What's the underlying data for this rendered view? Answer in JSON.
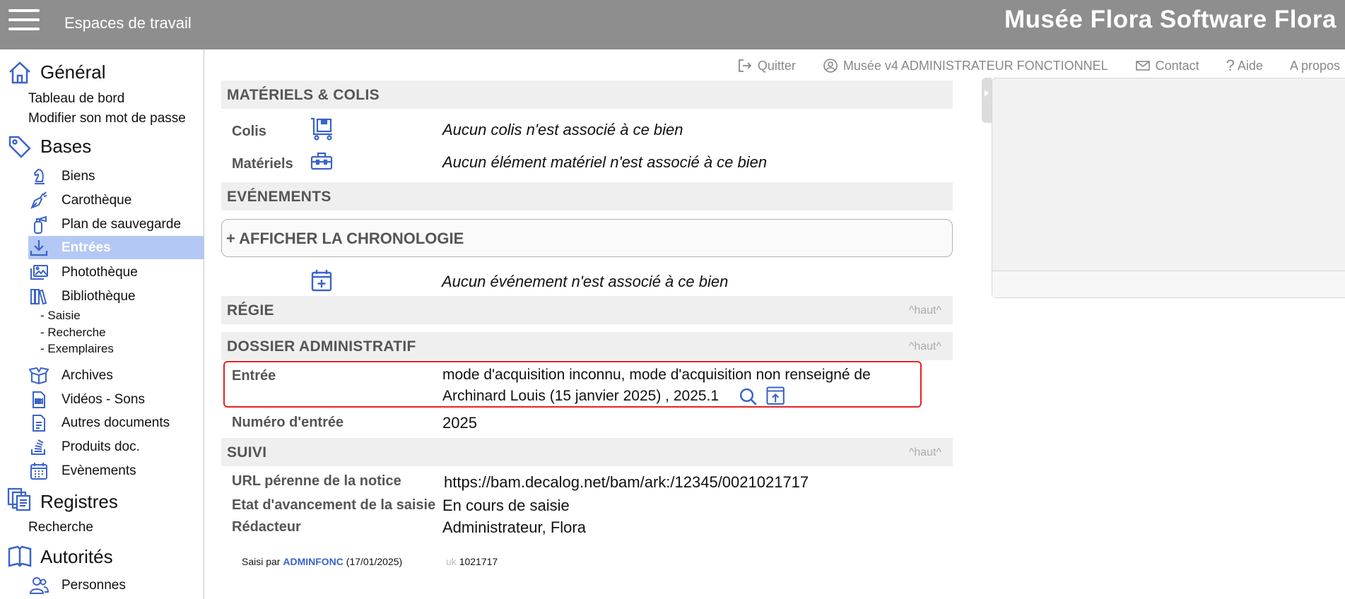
{
  "topbar": {
    "workspaces_label": "Espaces de travail",
    "brand": "Musée Flora Software Flora"
  },
  "utilbar": {
    "quit": "Quitter",
    "user": "Musée v4 ADMINISTRATEUR FONCTIONNEL",
    "contact": "Contact",
    "help": "Aide",
    "about": "A propos"
  },
  "sidebar": {
    "general": {
      "title": "Général",
      "links": [
        "Tableau de bord",
        "Modifier son mot de passe"
      ]
    },
    "bases": {
      "title": "Bases",
      "items": [
        {
          "label": "Biens",
          "icon": "chess-knight-icon"
        },
        {
          "label": "Carothèque",
          "icon": "pen-nib-icon"
        },
        {
          "label": "Plan de sauvegarde",
          "icon": "fire-extinguisher-icon"
        },
        {
          "label": "Entrées",
          "icon": "download-tray-icon"
        },
        {
          "label": "Photothèque",
          "icon": "images-icon"
        },
        {
          "label": "Bibliothèque",
          "icon": "books-icon"
        },
        {
          "label": "Archives",
          "icon": "open-box-icon"
        },
        {
          "label": "Vidéos - Sons",
          "icon": "video-file-icon"
        },
        {
          "label": "Autres documents",
          "icon": "document-icon"
        },
        {
          "label": "Produits doc.",
          "icon": "stack-icon"
        },
        {
          "label": "Evènements",
          "icon": "calendar-icon"
        }
      ],
      "library_sub": [
        "- Saisie",
        "- Recherche",
        "- Exemplaires"
      ]
    },
    "registres": {
      "title": "Registres",
      "links": [
        "Recherche"
      ]
    },
    "autorites": {
      "title": "Autorités",
      "items": [
        {
          "label": "Personnes",
          "icon": "users-icon"
        }
      ]
    }
  },
  "colors": {
    "accent": "#3b63c9",
    "topbar": "#8e8e8e",
    "active_item": "#b4c8f5",
    "highlight_border": "#e0242c"
  },
  "main": {
    "materiels": {
      "title": "MATÉRIELS & COLIS",
      "colis_label": "Colis",
      "colis_value": "Aucun colis n'est associé à ce bien",
      "materiels_label": "Matériels",
      "materiels_value": "Aucun élément matériel n'est associé à ce bien"
    },
    "evenements": {
      "title": "EVÉNEMENTS",
      "chrono_button": "+ AFFICHER LA CHRONOLOGIE",
      "empty_value": "Aucun événement n'est associé à ce bien"
    },
    "regie": {
      "title": "RÉGIE",
      "top_link": "^haut^"
    },
    "dossier": {
      "title": "DOSSIER ADMINISTRATIF",
      "top_link": "^haut^",
      "entree_label": "Entrée",
      "entree_line1": "mode d'acquisition inconnu, mode d'acquisition non renseigné de",
      "entree_line2": "Archinard Louis (15 janvier 2025) , 2025.1",
      "numero_label": "Numéro d'entrée",
      "numero_value": "2025"
    },
    "suivi": {
      "title": "SUIVI",
      "top_link": "^haut^",
      "url_label": "URL pérenne de la notice",
      "url_value": "https://bam.decalog.net/bam/ark:/12345/0021021717",
      "etat_label": "Etat d'avancement de la saisie",
      "etat_value": "En cours de saisie",
      "redacteur_label": "Rédacteur",
      "redacteur_value": "Administrateur, Flora"
    },
    "footer": {
      "saisi_prefix": "Saisi par",
      "saisi_user": "ADMINFONC",
      "saisi_date": "(17/01/2025)",
      "uk_label": "uk",
      "uk_value": "1021717"
    }
  }
}
